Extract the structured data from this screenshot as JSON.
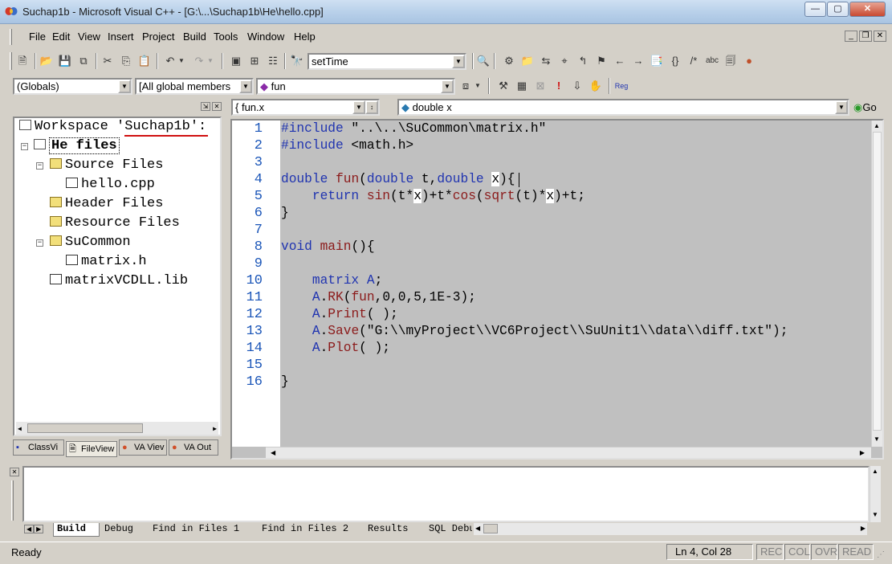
{
  "window": {
    "title": "Suchap1b - Microsoft Visual C++ - [G:\\...\\Suchap1b\\He\\hello.cpp]",
    "controls": {
      "minimize": "—",
      "maximize": "▢",
      "close": "✕"
    }
  },
  "menu": {
    "items": [
      "File",
      "Edit",
      "View",
      "Insert",
      "Project",
      "Build",
      "Tools",
      "Window",
      "Help"
    ]
  },
  "toolbar": {
    "find_combo": "setTime"
  },
  "wizardbar": {
    "class_combo": "(Globals)",
    "filter_combo": "[All global members",
    "member_combo": "fun"
  },
  "editorbar": {
    "scope_combo": "fun.x",
    "symbol_combo": "double x",
    "go_label": "Go"
  },
  "workspace": {
    "title": "Workspace 'Suchap1b':",
    "project": "He files",
    "items": [
      {
        "label": "Source Files",
        "kind": "folder",
        "expanded": true
      },
      {
        "label": "hello.cpp",
        "kind": "cpp"
      },
      {
        "label": "Header Files",
        "kind": "folder"
      },
      {
        "label": "Resource Files",
        "kind": "folder"
      },
      {
        "label": "SuCommon",
        "kind": "folder",
        "expanded": true
      },
      {
        "label": "matrix.h",
        "kind": "file"
      },
      {
        "label": "matrixVCDLL.lib",
        "kind": "file"
      }
    ],
    "tabs": [
      "ClassVi",
      "FileView",
      "VA Viev",
      "VA Out"
    ]
  },
  "editor": {
    "line_numbers": [
      "1",
      "2",
      "3",
      "4",
      "5",
      "6",
      "7",
      "8",
      "9",
      "10",
      "11",
      "12",
      "13",
      "14",
      "15",
      "16"
    ],
    "code": {
      "l1_kw": "#include",
      "l1_rest": " \"..\\..\\SuCommon\\matrix.h\"",
      "l2_kw": "#include",
      "l2_rest": " <math.h>",
      "l4": [
        "double",
        " ",
        "fun",
        "(",
        "double",
        " t,",
        "double",
        " ",
        "x",
        "){"
      ],
      "l5": [
        "    ",
        "return",
        " ",
        "sin",
        "(t*",
        "x",
        ")+t*",
        "cos",
        "(",
        "sqrt",
        "(t)*",
        "x",
        ")+t;"
      ],
      "l6": "}",
      "l8": [
        "void",
        " ",
        "main",
        "(){"
      ],
      "l10": [
        "    ",
        "matrix",
        " ",
        "A",
        ";"
      ],
      "l11": [
        "    ",
        "A",
        ".",
        "RK",
        "(",
        "fun",
        ",0,0,5,1E-3);"
      ],
      "l12": [
        "    ",
        "A",
        ".",
        "Print",
        "( );"
      ],
      "l13": [
        "    ",
        "A",
        ".",
        "Save",
        "(\"G:\\\\myProject\\\\VC6Project\\\\SuUnit1\\\\data\\\\diff.txt\");"
      ],
      "l14": [
        "    ",
        "A",
        ".",
        "Plot",
        "( );"
      ],
      "l16": "}"
    }
  },
  "output": {
    "tabs": [
      "Build",
      "Debug",
      "Find in Files 1",
      "Find in Files 2",
      "Results",
      "SQL Debu"
    ]
  },
  "statusbar": {
    "text": "Ready",
    "position": "Ln 4, Col 28",
    "indicators": [
      "REC",
      "COL",
      "OVR",
      "READ"
    ]
  },
  "colors": {
    "keyword": "#2034b0",
    "function": "#8b1a1a",
    "line_number": "#1a55b8",
    "editor_bg": "#c0c0c0"
  }
}
